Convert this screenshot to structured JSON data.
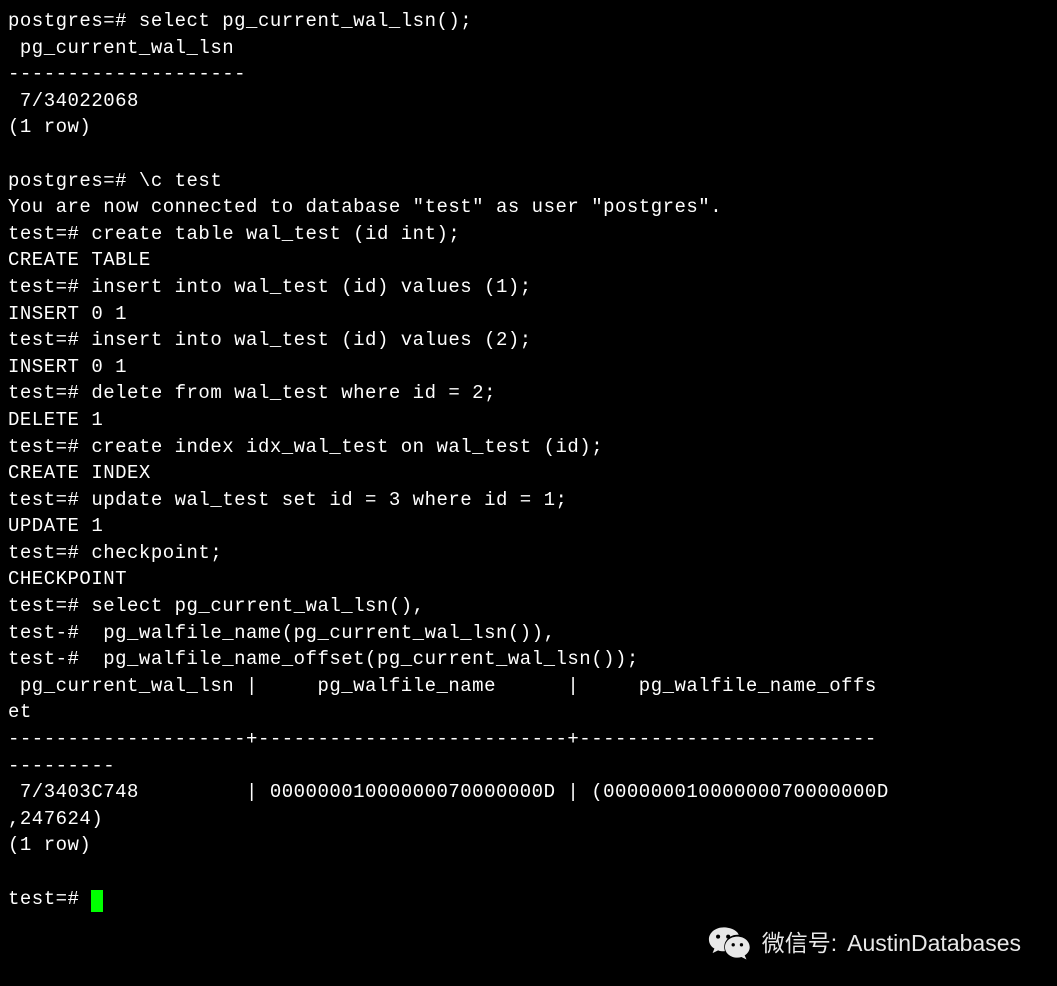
{
  "terminal": {
    "lines": [
      "postgres=# select pg_current_wal_lsn();",
      " pg_current_wal_lsn ",
      "--------------------",
      " 7/34022068",
      "(1 row)",
      "",
      "postgres=# \\c test",
      "You are now connected to database \"test\" as user \"postgres\".",
      "test=# create table wal_test (id int);",
      "CREATE TABLE",
      "test=# insert into wal_test (id) values (1);",
      "INSERT 0 1",
      "test=# insert into wal_test (id) values (2);",
      "INSERT 0 1",
      "test=# delete from wal_test where id = 2;",
      "DELETE 1",
      "test=# create index idx_wal_test on wal_test (id);",
      "CREATE INDEX",
      "test=# update wal_test set id = 3 where id = 1;",
      "UPDATE 1",
      "test=# checkpoint;",
      "CHECKPOINT",
      "test=# select pg_current_wal_lsn(),",
      "test-#  pg_walfile_name(pg_current_wal_lsn()),",
      "test-#  pg_walfile_name_offset(pg_current_wal_lsn());",
      " pg_current_wal_lsn |     pg_walfile_name      |     pg_walfile_name_offs",
      "et      ",
      "--------------------+--------------------------+-------------------------",
      "---------",
      " 7/3403C748         | 00000001000000070000000D | (00000001000000070000000D",
      ",247624)",
      "(1 row)",
      ""
    ],
    "prompt": "test=# "
  },
  "watermark": {
    "label": "微信号:",
    "value": "AustinDatabases"
  }
}
